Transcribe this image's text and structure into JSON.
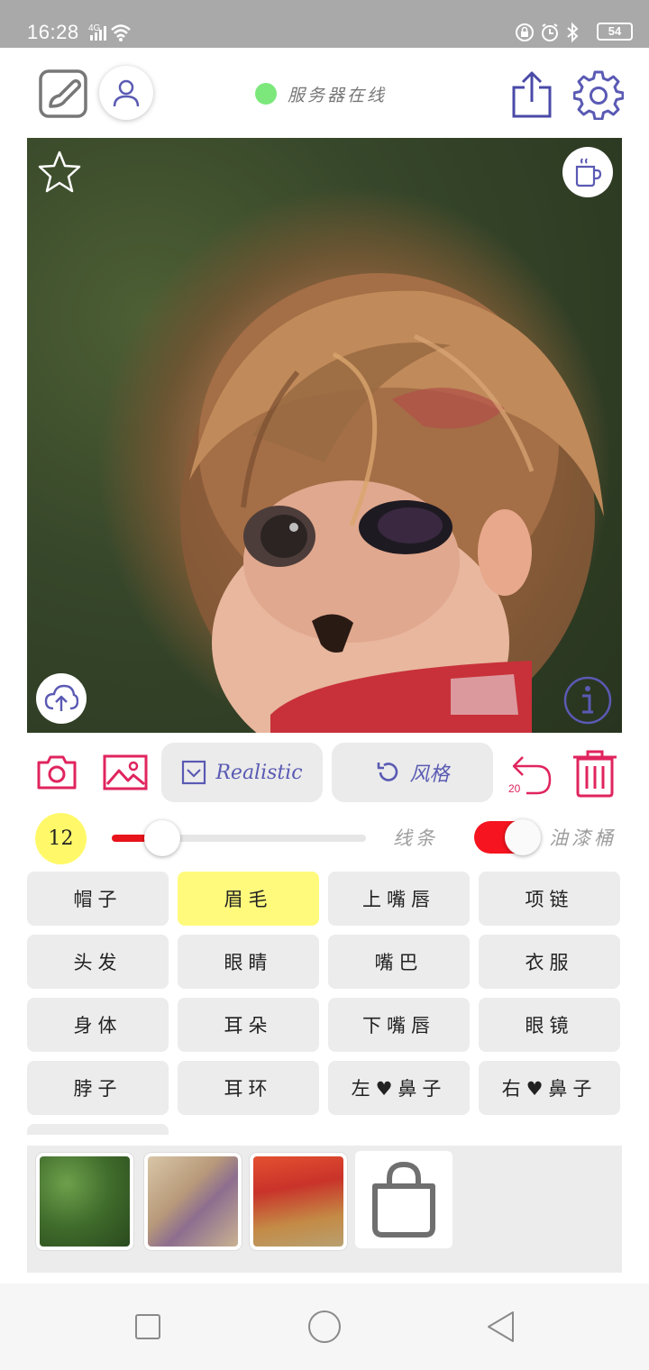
{
  "status_bar": {
    "time": "16:28",
    "network": "4G",
    "battery": "54"
  },
  "header": {
    "server_status": "服务器在线",
    "server_status_color": "#7ce87c"
  },
  "canvas": {
    "fav_icon": "star-icon",
    "cup_icon": "coffee-cup-icon",
    "upload_icon": "cloud-upload-icon",
    "info_icon": "info-icon"
  },
  "tools": {
    "realistic_label": "Realistic",
    "style_label": "风格",
    "undo_count": "20"
  },
  "brush": {
    "size": "12",
    "slider_fraction": 0.2,
    "line_label": "线条",
    "bucket_label": "油漆桶",
    "bucket_toggle_on": true
  },
  "parts": {
    "items": [
      {
        "label": "帽子",
        "selected": false
      },
      {
        "label": "眉毛",
        "selected": true
      },
      {
        "label": "上嘴唇",
        "selected": false
      },
      {
        "label": "项链",
        "selected": false
      },
      {
        "label": "头发",
        "selected": false
      },
      {
        "label": "眼睛",
        "selected": false
      },
      {
        "label": "嘴巴",
        "selected": false
      },
      {
        "label": "衣服",
        "selected": false
      },
      {
        "label": "身体",
        "selected": false
      },
      {
        "label": "耳朵",
        "selected": false
      },
      {
        "label": "下嘴唇",
        "selected": false
      },
      {
        "label": "眼镜",
        "selected": false
      },
      {
        "label": "脖子",
        "selected": false
      },
      {
        "label": "耳环",
        "selected": false
      },
      {
        "label": "左♥鼻子",
        "selected": false
      },
      {
        "label": "右♥鼻子",
        "selected": false
      }
    ]
  },
  "colors": {
    "accent_pink": "#e0245e",
    "accent_purple": "#5a5ab4",
    "selected_yellow": "#fff97c",
    "slider_red": "#e8141b"
  }
}
